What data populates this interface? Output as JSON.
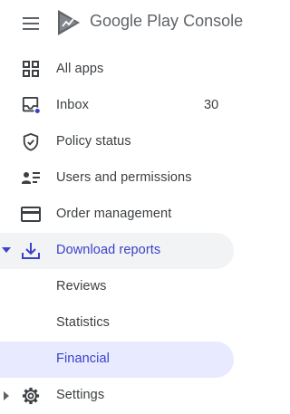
{
  "header": {
    "logo_word1": "Google Play",
    "logo_word2": "Console"
  },
  "nav": {
    "items": [
      {
        "label": "All apps",
        "icon": "grid-icon"
      },
      {
        "label": "Inbox",
        "icon": "inbox-icon",
        "count": "30"
      },
      {
        "label": "Policy status",
        "icon": "shield-check-icon"
      },
      {
        "label": "Users and permissions",
        "icon": "users-icon"
      },
      {
        "label": "Order management",
        "icon": "credit-card-icon"
      },
      {
        "label": "Download reports",
        "icon": "download-icon",
        "expanded": true
      },
      {
        "label": "Reviews"
      },
      {
        "label": "Statistics"
      },
      {
        "label": "Financial",
        "selected": true
      },
      {
        "label": "Settings",
        "icon": "gear-icon"
      }
    ]
  },
  "colors": {
    "accent": "#3b41c8",
    "selected_bg": "#e8eaff",
    "hover_bg": "#f1f3f4",
    "text": "#3c4043",
    "icon": "#5f6368",
    "badge_dot": "#3b41c8"
  }
}
